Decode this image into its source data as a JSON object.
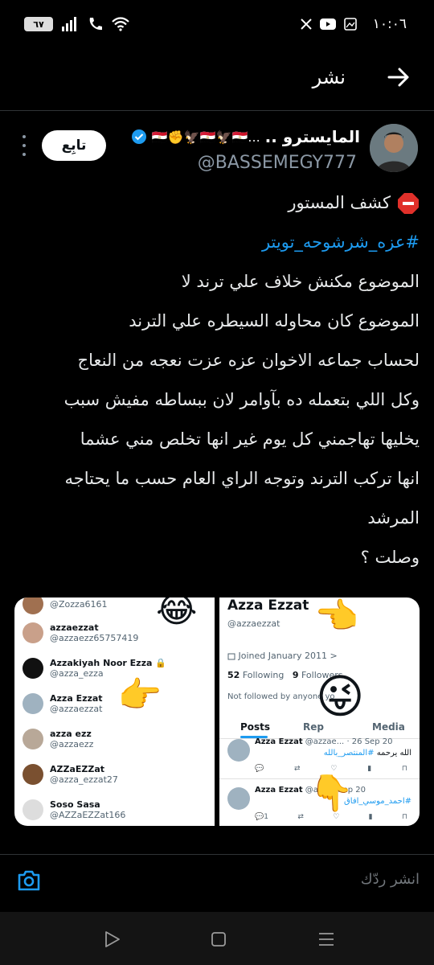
{
  "status_bar": {
    "time": "١٠:٠٦",
    "battery": "٦٧"
  },
  "header": {
    "title": "نشر"
  },
  "tweet": {
    "display_name": "المايسترو ..",
    "name_emojis": "🇪🇬✊🦅🇪🇬🦅🇪🇬...",
    "handle": "@BASSEMEGY777",
    "follow_label": "تابِع",
    "body": {
      "line1": "كشف المستور",
      "hashtag": "#عزه_شرشوحه_تويتر",
      "line3": "الموضوع مكنش خلاف علي ترند لا",
      "line4": "الموضوع كان محاوله السيطره علي الترند",
      "line5": "لحساب جماعه الاخوان عزه عزت نعجه من النعاج",
      "line6": "وكل اللي بتعمله ده بآوامر لان ببساطه مفيش سبب",
      "line7": "يخليها تهاجمني كل يوم غير انها تخلص مني  عشما",
      "line8": "انها تركب الترند وتوجه الراي العام حسب ما يحتاجه",
      "line9": "المرشد",
      "line10": "وصلت ؟"
    }
  },
  "media": {
    "left_accounts": [
      {
        "name": "",
        "handle": "@Zozza6161"
      },
      {
        "name": "azzaezzat",
        "handle": "@azzaezz65757419"
      },
      {
        "name": "Azzakiyah Noor Ezza 🔒",
        "handle": "@azza_ezza"
      },
      {
        "name": "Azza Ezzat",
        "handle": "@azzaezzat"
      },
      {
        "name": "azza ezz",
        "handle": "@azzaezz"
      },
      {
        "name": "AZZaEZZat",
        "handle": "@azza_ezzat27"
      },
      {
        "name": "Soso Sasa",
        "handle": "@AZZaEZZat166"
      }
    ],
    "profile": {
      "name": "Azza Ezzat",
      "handle": "@azzaezzat",
      "joined": "Joined January 2011",
      "following_count": "52",
      "following_label": "Following",
      "followers_count": "9",
      "followers_label": "Followers",
      "not_followed": "Not followed by anyone yo",
      "tabs": [
        "Posts",
        "Rep",
        "Media"
      ],
      "tweets": [
        {
          "name": "Azza Ezzat",
          "handle": "@azzae...",
          "date": "· 26 Sep 20",
          "text": "الله يرحمه ",
          "hashtag": "#المنتصر_بالله",
          "counts": [
            "",
            "",
            "",
            "",
            ""
          ]
        },
        {
          "name": "Azza Ezzat",
          "handle": "@az",
          "date": "07 Sep 20",
          "text": "",
          "hashtag": "#احمد_موسي_افاق",
          "counts": [
            "1",
            "",
            "",
            "",
            ""
          ]
        }
      ]
    }
  },
  "reply": {
    "placeholder": "انشر ردّك"
  },
  "colors": {
    "accent": "#1d9bf0",
    "background": "#000000",
    "text": "#e7e9ea",
    "secondary_text": "#8b98a5"
  }
}
